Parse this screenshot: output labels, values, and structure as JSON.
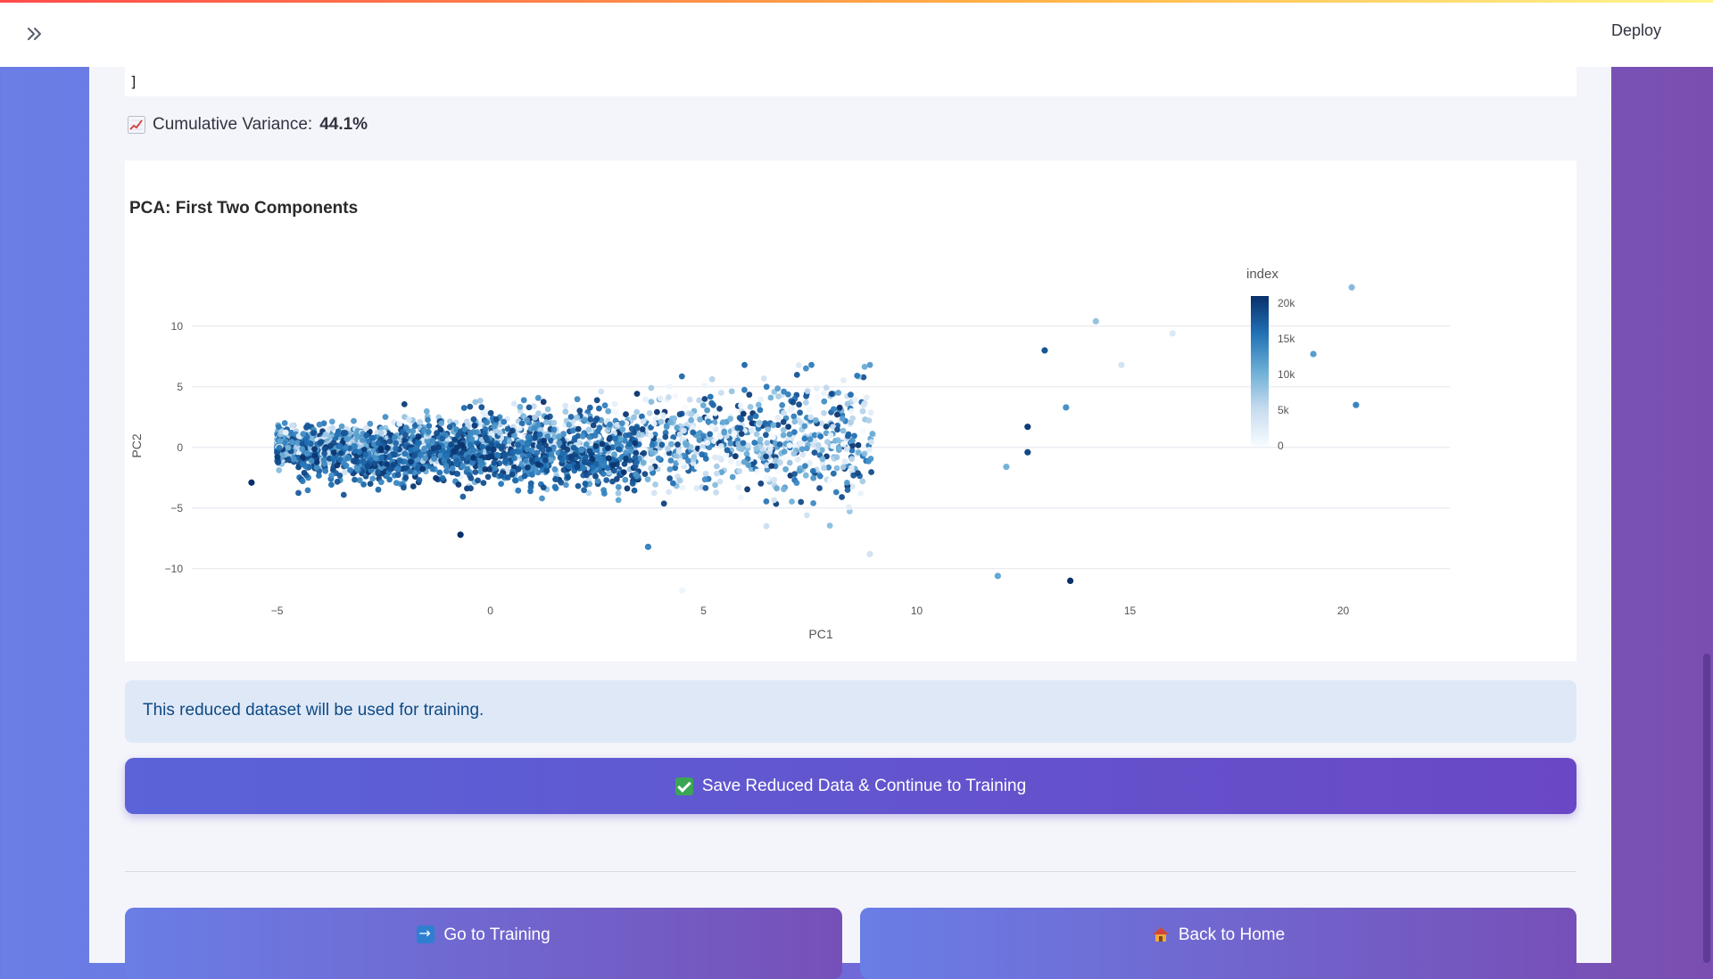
{
  "header": {
    "deploy_label": "Deploy",
    "expand_icon": "chevron-double-right-icon"
  },
  "code_tail": {
    "text": "]"
  },
  "variance": {
    "label": "Cumulative Variance:",
    "value": "44.1%",
    "icon": "chart-increasing-icon"
  },
  "chart": {
    "title": "PCA: First Two Components",
    "xlabel": "PC1",
    "ylabel": "PC2",
    "colorbar_title": "index",
    "colorbar_ticks": [
      "20k",
      "15k",
      "10k",
      "5k",
      "0"
    ],
    "x_ticks": [
      "−5",
      "0",
      "5",
      "10",
      "15",
      "20"
    ],
    "y_ticks": [
      "10",
      "5",
      "0",
      "−5",
      "−10"
    ]
  },
  "chart_data": {
    "type": "scatter",
    "title": "PCA: First Two Components",
    "xlabel": "PC1",
    "ylabel": "PC2",
    "xlim": [
      -7,
      22.5
    ],
    "ylim": [
      -12,
      13
    ],
    "color_by": "index",
    "color_range": [
      0,
      21000
    ],
    "colorscale": "Blues",
    "grid": "horizontal",
    "legend": "colorbar-right",
    "highlighted_points": [
      {
        "x": 20.2,
        "y": 13.2,
        "index": 9000
      },
      {
        "x": 14.2,
        "y": 10.4,
        "index": 8000
      },
      {
        "x": 16.0,
        "y": 9.4,
        "index": 3000
      },
      {
        "x": 19.3,
        "y": 7.7,
        "index": 12000
      },
      {
        "x": 20.3,
        "y": 3.5,
        "index": 14000
      },
      {
        "x": 13.0,
        "y": 8.0,
        "index": 18000
      },
      {
        "x": 14.8,
        "y": 6.8,
        "index": 4000
      },
      {
        "x": 13.5,
        "y": 3.3,
        "index": 13000
      },
      {
        "x": 12.6,
        "y": 1.7,
        "index": 20000
      },
      {
        "x": 12.6,
        "y": -0.4,
        "index": 19000
      },
      {
        "x": 12.1,
        "y": -1.6,
        "index": 10000
      },
      {
        "x": 11.9,
        "y": -10.6,
        "index": 11000
      },
      {
        "x": 13.6,
        "y": -11.0,
        "index": 21000
      },
      {
        "x": 4.5,
        "y": -11.8,
        "index": 1000
      },
      {
        "x": 8.9,
        "y": -8.8,
        "index": 4000
      },
      {
        "x": 3.7,
        "y": -8.2,
        "index": 14000
      },
      {
        "x": -5.6,
        "y": -2.9,
        "index": 21000
      },
      {
        "x": -0.7,
        "y": -7.2,
        "index": 21000
      }
    ],
    "point_count_approx": 21000,
    "dense_region": {
      "x": [
        -5,
        9
      ],
      "y": [
        -6,
        6
      ]
    }
  },
  "info": {
    "text": "This reduced dataset will be used for training."
  },
  "buttons": {
    "save": "Save Reduced Data & Continue to Training",
    "training": "Go to Training",
    "home": "Back to Home"
  },
  "icons": {
    "save": "check-mark-icon",
    "training": "right-arrow-icon",
    "home": "house-icon"
  }
}
